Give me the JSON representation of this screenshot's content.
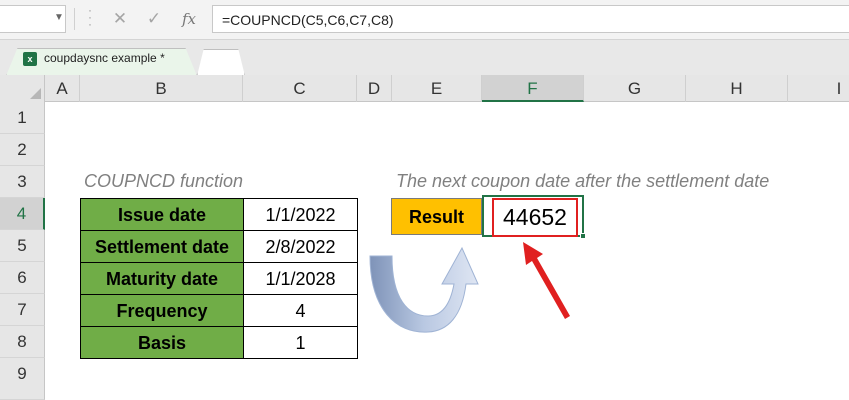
{
  "formula_bar": {
    "name_box": "",
    "formula": "=COUPNCD(C5,C6,C7,C8)",
    "icons": [
      "cancel-icon",
      "enter-icon",
      "function-icon"
    ],
    "cancel_glyph": "✕",
    "enter_glyph": "✓",
    "fx_glyph": "fx"
  },
  "tabs": [
    {
      "label": "coupdaysnc example *",
      "active": true
    }
  ],
  "columns": [
    "A",
    "B",
    "C",
    "D",
    "E",
    "F",
    "G",
    "H",
    "I"
  ],
  "rows": [
    "1",
    "2",
    "3",
    "4",
    "5",
    "6",
    "7",
    "8",
    "9"
  ],
  "selected": {
    "column": "F",
    "row": "4"
  },
  "sheet": {
    "title": "COUPNCD function",
    "caption": "The next coupon date after the settlement date",
    "table": [
      {
        "label": "Issue date",
        "value": "1/1/2022"
      },
      {
        "label": "Settlement date",
        "value": "2/8/2022"
      },
      {
        "label": "Maturity date",
        "value": "1/1/2028"
      },
      {
        "label": "Frequency",
        "value": "4"
      },
      {
        "label": "Basis",
        "value": "1"
      }
    ],
    "result_label": "Result",
    "result_value": "44652"
  },
  "colors": {
    "label_fill": "#70ad47",
    "result_fill": "#ffc000",
    "selection": "#217346",
    "highlight": "#e02020",
    "arrow": "#8fa9d3"
  }
}
